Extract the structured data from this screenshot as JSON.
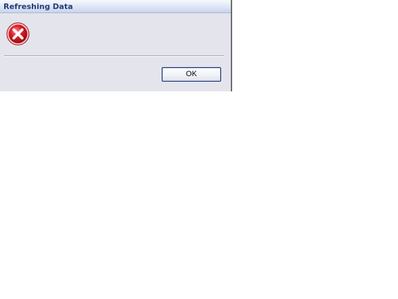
{
  "dialog": {
    "title": "Refreshing Data",
    "icon": "error-icon",
    "ok_label": "OK"
  },
  "colors": {
    "dialog_background": "#e4e4ec",
    "title_text": "#233e7b",
    "error_red": "#d7141a"
  }
}
